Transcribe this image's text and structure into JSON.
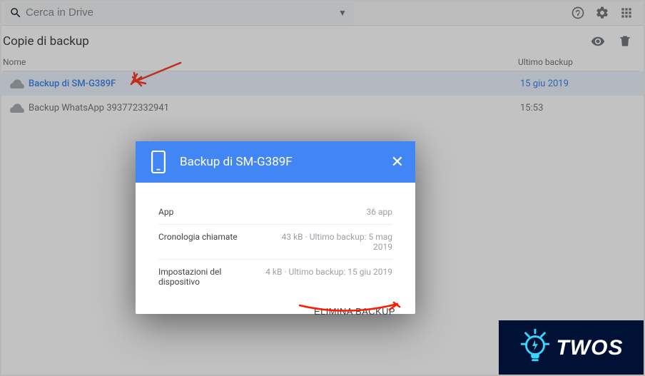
{
  "search": {
    "placeholder": "Cerca in Drive"
  },
  "page": {
    "title": "Copie di backup"
  },
  "columns": {
    "name": "Nome",
    "last_backup": "Ultimo backup"
  },
  "rows": [
    {
      "name": "Backup di SM-G389F",
      "date": "15 giu 2019"
    },
    {
      "name": "Backup WhatsApp 393772332941",
      "date": "15:53"
    }
  ],
  "modal": {
    "title": "Backup di SM-G389F",
    "sections": [
      {
        "label": "App",
        "value": "36 app"
      },
      {
        "label": "Cronologia chiamate",
        "value": "43 kB · Ultimo backup: 5 mag 2019"
      },
      {
        "label": "Impostazioni del dispositivo",
        "value": "4 kB · Ultimo backup: 15 giu 2019"
      }
    ],
    "delete_label": "ELIMINA BACKUP"
  },
  "logo": {
    "text": "TWOS"
  }
}
